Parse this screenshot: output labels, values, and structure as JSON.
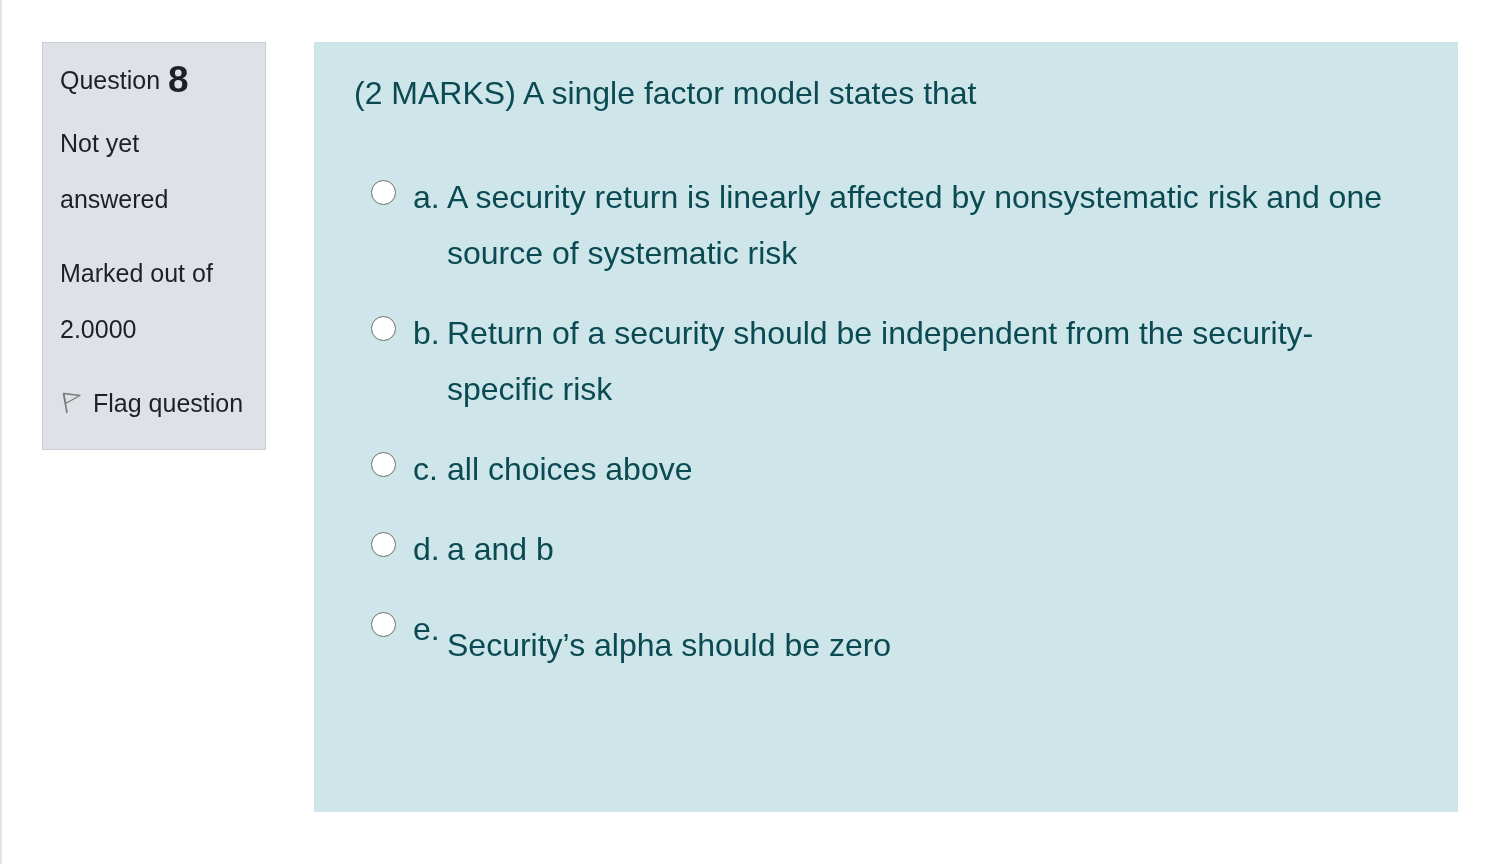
{
  "question_info": {
    "label": "Question",
    "number": "8",
    "state": "Not yet answered",
    "marks": "Marked out of 2.0000",
    "flag": {
      "label": "Flag question",
      "flagged": false
    }
  },
  "question": {
    "text": "(2 MARKS) A single factor model states that",
    "options": [
      {
        "letter": "a.",
        "text": "A security return is linearly affected by nonsystematic risk and one source of systematic risk",
        "selected": false,
        "kind": "inline"
      },
      {
        "letter": "b.",
        "text": "Return of a security should be independent from the security-specific risk",
        "selected": false,
        "kind": "inline"
      },
      {
        "letter": "c.",
        "text": "all choices above",
        "selected": false,
        "kind": "inline"
      },
      {
        "letter": "d.",
        "text": "a and b",
        "selected": false,
        "kind": "inline"
      },
      {
        "letter": "e.",
        "text": "Security’s alpha should be zero",
        "selected": false,
        "kind": "dropped"
      }
    ]
  }
}
